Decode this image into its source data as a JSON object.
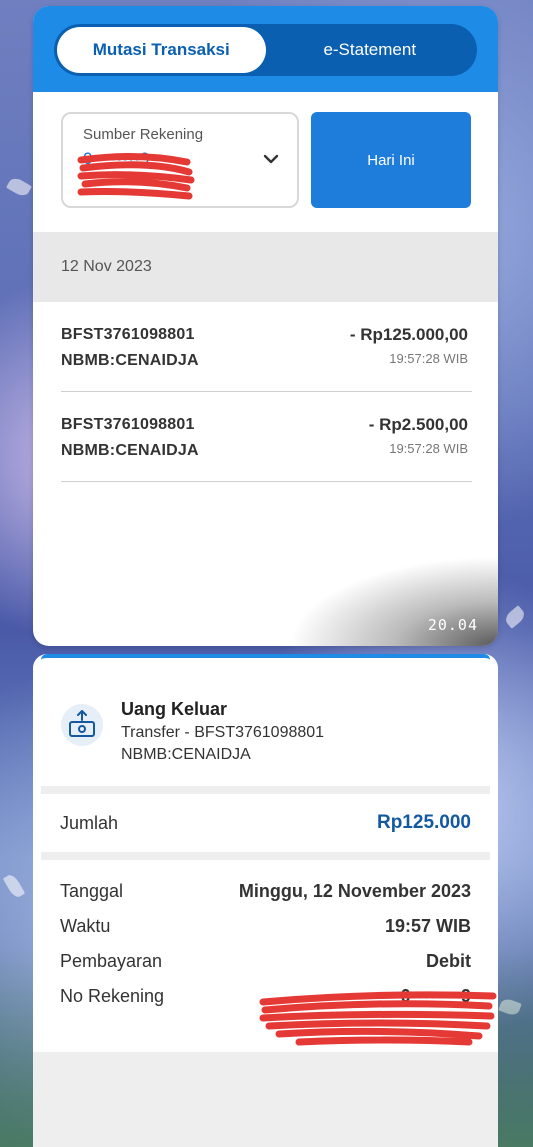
{
  "tabs": {
    "active": "Mutasi Transaksi",
    "inactive": "e-Statement"
  },
  "filter": {
    "account_label": "Sumber Rekening",
    "account_value": "0••••••••9",
    "date_button": "Hari Ini"
  },
  "date_header": "12 Nov 2023",
  "transactions": [
    {
      "ref": "BFST3761098801",
      "desc": "NBMB:CENAIDJA",
      "amount": "- Rp125.000,00",
      "time": "19:57:28 WIB"
    },
    {
      "ref": "BFST3761098801",
      "desc": "NBMB:CENAIDJA",
      "amount": "- Rp2.500,00",
      "time": "19:57:28 WIB"
    }
  ],
  "overlay_time": "20.04",
  "detail": {
    "title": "Uang Keluar",
    "desc_line1": "Transfer - BFST3761098801",
    "desc_line2": "NBMB:CENAIDJA",
    "amount_label": "Jumlah",
    "amount_value": "Rp125.000",
    "rows": [
      {
        "label": "Tanggal",
        "value": "Minggu, 12 November 2023"
      },
      {
        "label": "Waktu",
        "value": "19:57 WIB"
      },
      {
        "label": "Pembayaran",
        "value": "Debit"
      },
      {
        "label": "No Rekening",
        "value": "0••••••••9"
      }
    ]
  },
  "colors": {
    "primary": "#1e8be6",
    "primary_dark": "#0a5fb0",
    "amount_blue": "#1459a0",
    "redaction": "#e53935"
  },
  "icons": {
    "chevron": "chevron-down-icon",
    "transfer_out": "money-out-icon"
  }
}
